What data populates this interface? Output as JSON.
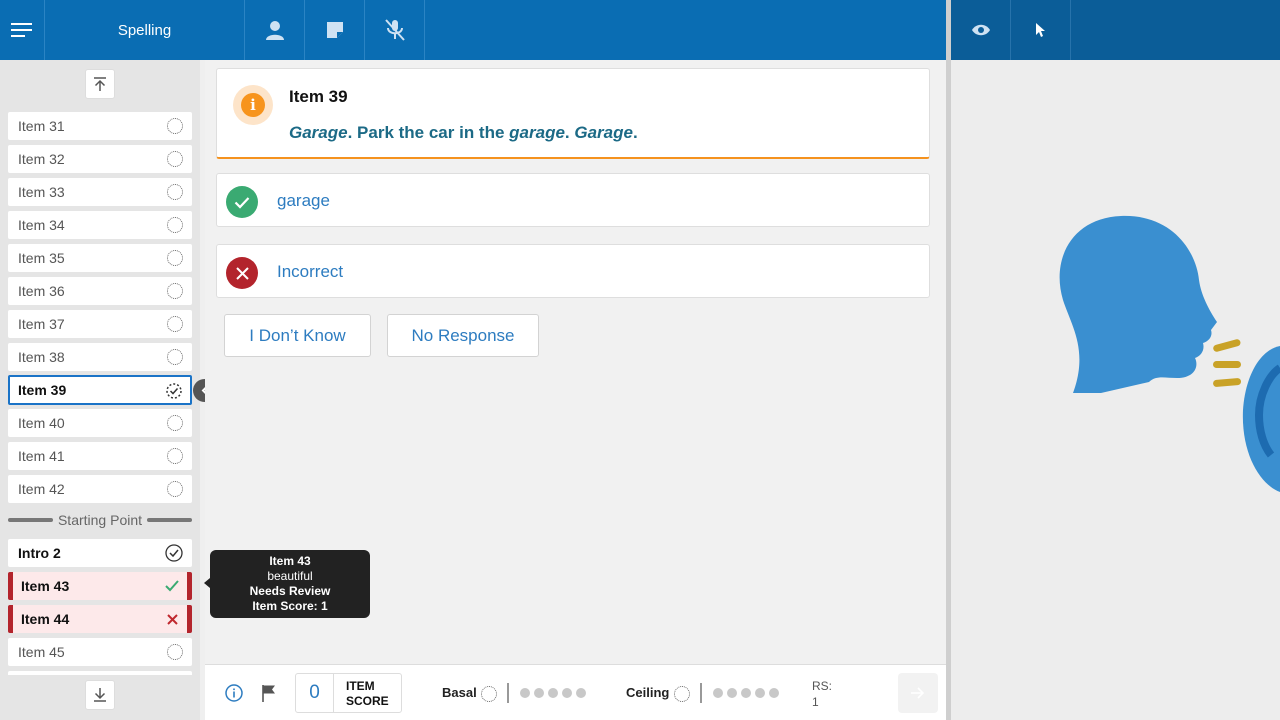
{
  "header": {
    "title": "Spelling"
  },
  "sidebar": {
    "items": [
      {
        "label": "Item 31",
        "state": "pending"
      },
      {
        "label": "Item 32",
        "state": "pending"
      },
      {
        "label": "Item 33",
        "state": "pending"
      },
      {
        "label": "Item 34",
        "state": "pending"
      },
      {
        "label": "Item 35",
        "state": "pending"
      },
      {
        "label": "Item 36",
        "state": "pending"
      },
      {
        "label": "Item 37",
        "state": "pending"
      },
      {
        "label": "Item 38",
        "state": "pending"
      },
      {
        "label": "Item 39",
        "state": "active"
      },
      {
        "label": "Item 40",
        "state": "pending"
      },
      {
        "label": "Item 41",
        "state": "pending"
      },
      {
        "label": "Item 42",
        "state": "pending"
      }
    ],
    "starting_point_label": "Starting Point",
    "intro_label": "Intro 2",
    "review_items": [
      {
        "label": "Item 43",
        "result": "correct"
      },
      {
        "label": "Item 44",
        "result": "incorrect"
      }
    ],
    "after_items": [
      {
        "label": "Item 45",
        "state": "pending"
      }
    ]
  },
  "item_card": {
    "title": "Item 39",
    "prompt_word": "Garage",
    "prompt_middle": ". Park the car in the ",
    "prompt_word2": "garage",
    "prompt_sep": ". ",
    "prompt_word3": "Garage",
    "prompt_end": "."
  },
  "responses": {
    "correct_label": "garage",
    "incorrect_label": "Incorrect"
  },
  "buttons": {
    "dont_know": "I Don’t Know",
    "no_response": "No Response"
  },
  "tooltip": {
    "item": "Item 43",
    "word": "beautiful",
    "status": "Needs Review",
    "score": "Item Score: 1"
  },
  "footer": {
    "item_score": "0",
    "item_score_label_1": "ITEM",
    "item_score_label_2": "SCORE",
    "basal_label": "Basal",
    "ceiling_label": "Ceiling",
    "rs_label": "RS:",
    "rs_value": "1"
  },
  "colors": {
    "header_blue": "#0a6db3",
    "header_right_blue": "#0b5d98",
    "accent_orange": "#f7941d",
    "correct_green": "#3aaa72",
    "incorrect_red": "#b3242c",
    "link_blue": "#2d7cc0"
  }
}
